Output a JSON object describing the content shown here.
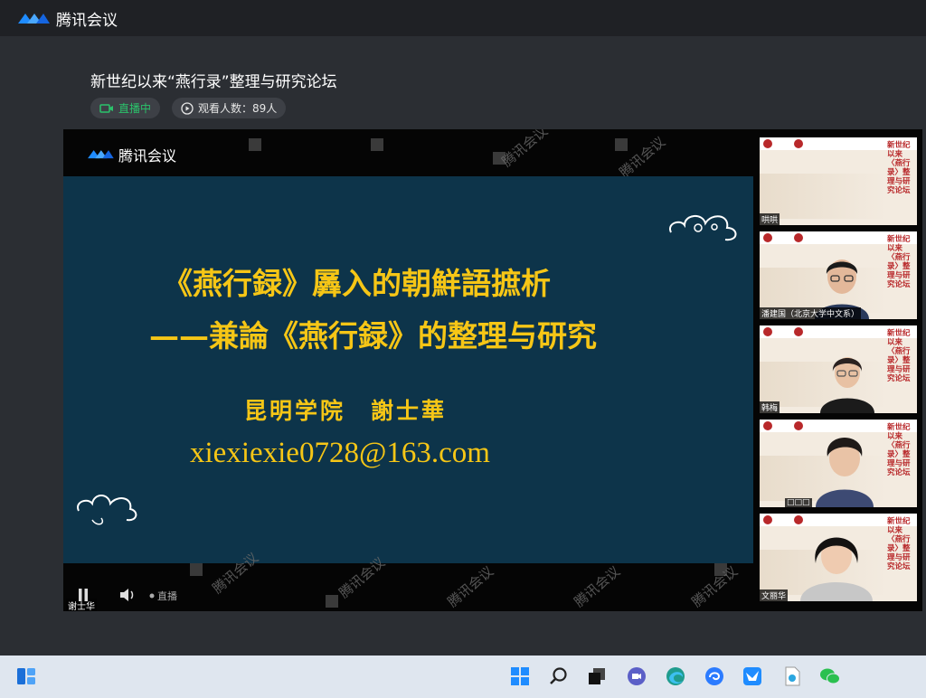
{
  "app": {
    "name": "腾讯会议"
  },
  "meeting": {
    "title": "新世纪以来“燕行录”整理与研究论坛",
    "status": "直播中",
    "viewers": "观看人数：89人"
  },
  "video": {
    "watermark": "腾讯会议",
    "slide": {
      "line1": "《燕行録》羼入的朝鮮語摭析",
      "line2": "——兼論《燕行録》的整理与研究",
      "author": "昆明学院　謝士華",
      "email": "xiexiexie0728@163.com"
    },
    "speaker": "谢士华",
    "controls": {
      "live_label": "直播"
    }
  },
  "participants": [
    {
      "name": "哄哄"
    },
    {
      "name": "潘建国（北京大学中文系）"
    },
    {
      "name": "韩梅"
    },
    {
      "name": "□□□"
    },
    {
      "name": "文丽华"
    }
  ],
  "thumb_slide_title": "新世纪以来〈燕行录〉整理与研究论坛",
  "colors": {
    "slide_bg": "#0d344a",
    "slide_text": "#f6c616",
    "live_green": "#2bc26b",
    "seal_red": "#b8282a"
  },
  "taskbar": {
    "icons": [
      "widgets-icon",
      "windows-start-icon",
      "search-icon",
      "task-view-icon",
      "meet-icon",
      "edge-icon",
      "swirl-app-icon",
      "bird-app-icon",
      "document-icon",
      "wechat-icon"
    ]
  }
}
